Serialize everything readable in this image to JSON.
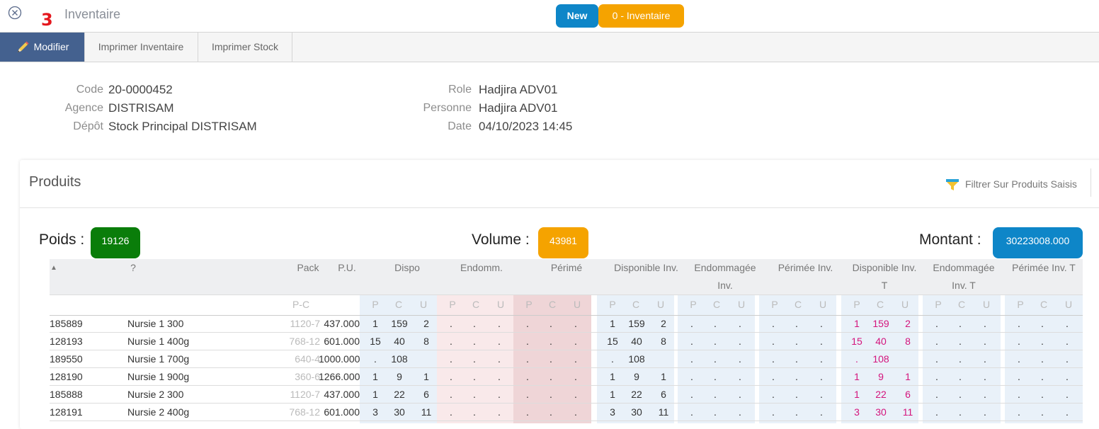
{
  "header": {
    "step_number": "3",
    "title": "Inventaire",
    "badge_new": "New",
    "badge_status": "0 - Inventaire"
  },
  "toolbar": {
    "modifier": "Modifier",
    "imprimer_inventaire": "Imprimer Inventaire",
    "imprimer_stock": "Imprimer Stock"
  },
  "info": {
    "code_label": "Code",
    "code_value": "20-0000452",
    "agence_label": "Agence",
    "agence_value": "DISTRISAM",
    "depot_label": "Dépôt",
    "depot_value": "Stock Principal DISTRISAM",
    "role_label": "Role",
    "role_value": "Hadjira ADV01",
    "personne_label": "Personne",
    "personne_value": "Hadjira ADV01",
    "date_label": "Date",
    "date_value": "04/10/2023 14:45"
  },
  "panel": {
    "title": "Produits",
    "filter_label": "Filtrer Sur Produits Saisis"
  },
  "summary": {
    "poids_label": "Poids :",
    "poids_value": "19126",
    "volume_label": "Volume :",
    "volume_value": "43981",
    "montant_label": "Montant :",
    "montant_value": "30223008.000"
  },
  "colors": {
    "poids": "#0a7d0a",
    "volume": "#f5a300",
    "montant": "#0e86c8",
    "toolbar_active": "#44618f"
  },
  "table": {
    "headers": {
      "sort": "▲",
      "designation": "?",
      "pack": "Pack",
      "pu": "P.U.",
      "dispo": "Dispo",
      "endomm": "Endomm.",
      "perime": "Périmé",
      "disp_inv": "Disponible Inv.",
      "endo_inv_1": "Endommagée",
      "endo_inv_2": "Inv.",
      "peri_inv": "Périmée Inv.",
      "disp_inv_t_1": "Disponible Inv.",
      "disp_inv_t_2": "T",
      "endo_inv_t_1": "Endommagée",
      "endo_inv_t_2": "Inv. T",
      "peri_inv_t": "Périmée Inv. T"
    },
    "sub": {
      "pc": "P-C",
      "p": "P",
      "c": "C",
      "u": "U"
    },
    "rows": [
      {
        "code": "185889",
        "name": "Nursie 1 300",
        "pack": "1120-7",
        "pu": "437.000",
        "p": "1",
        "c": "159",
        "u": "2"
      },
      {
        "code": "128193",
        "name": "Nursie 1 400g",
        "pack": "768-12",
        "pu": "601.000",
        "p": "15",
        "c": "40",
        "u": "8"
      },
      {
        "code": "189550",
        "name": "Nursie 1 700g",
        "pack": "640-4",
        "pu": "1000.000",
        "p": ".",
        "c": "108",
        "u": ""
      },
      {
        "code": "128190",
        "name": "Nursie 1 900g",
        "pack": "360-6",
        "pu": "1266.000",
        "p": "1",
        "c": "9",
        "u": "1"
      },
      {
        "code": "185888",
        "name": "Nursie 2 300",
        "pack": "1120-7",
        "pu": "437.000",
        "p": "1",
        "c": "22",
        "u": "6"
      },
      {
        "code": "128191",
        "name": "Nursie 2 400g",
        "pack": "768-12",
        "pu": "601.000",
        "p": "3",
        "c": "30",
        "u": "11"
      }
    ]
  }
}
